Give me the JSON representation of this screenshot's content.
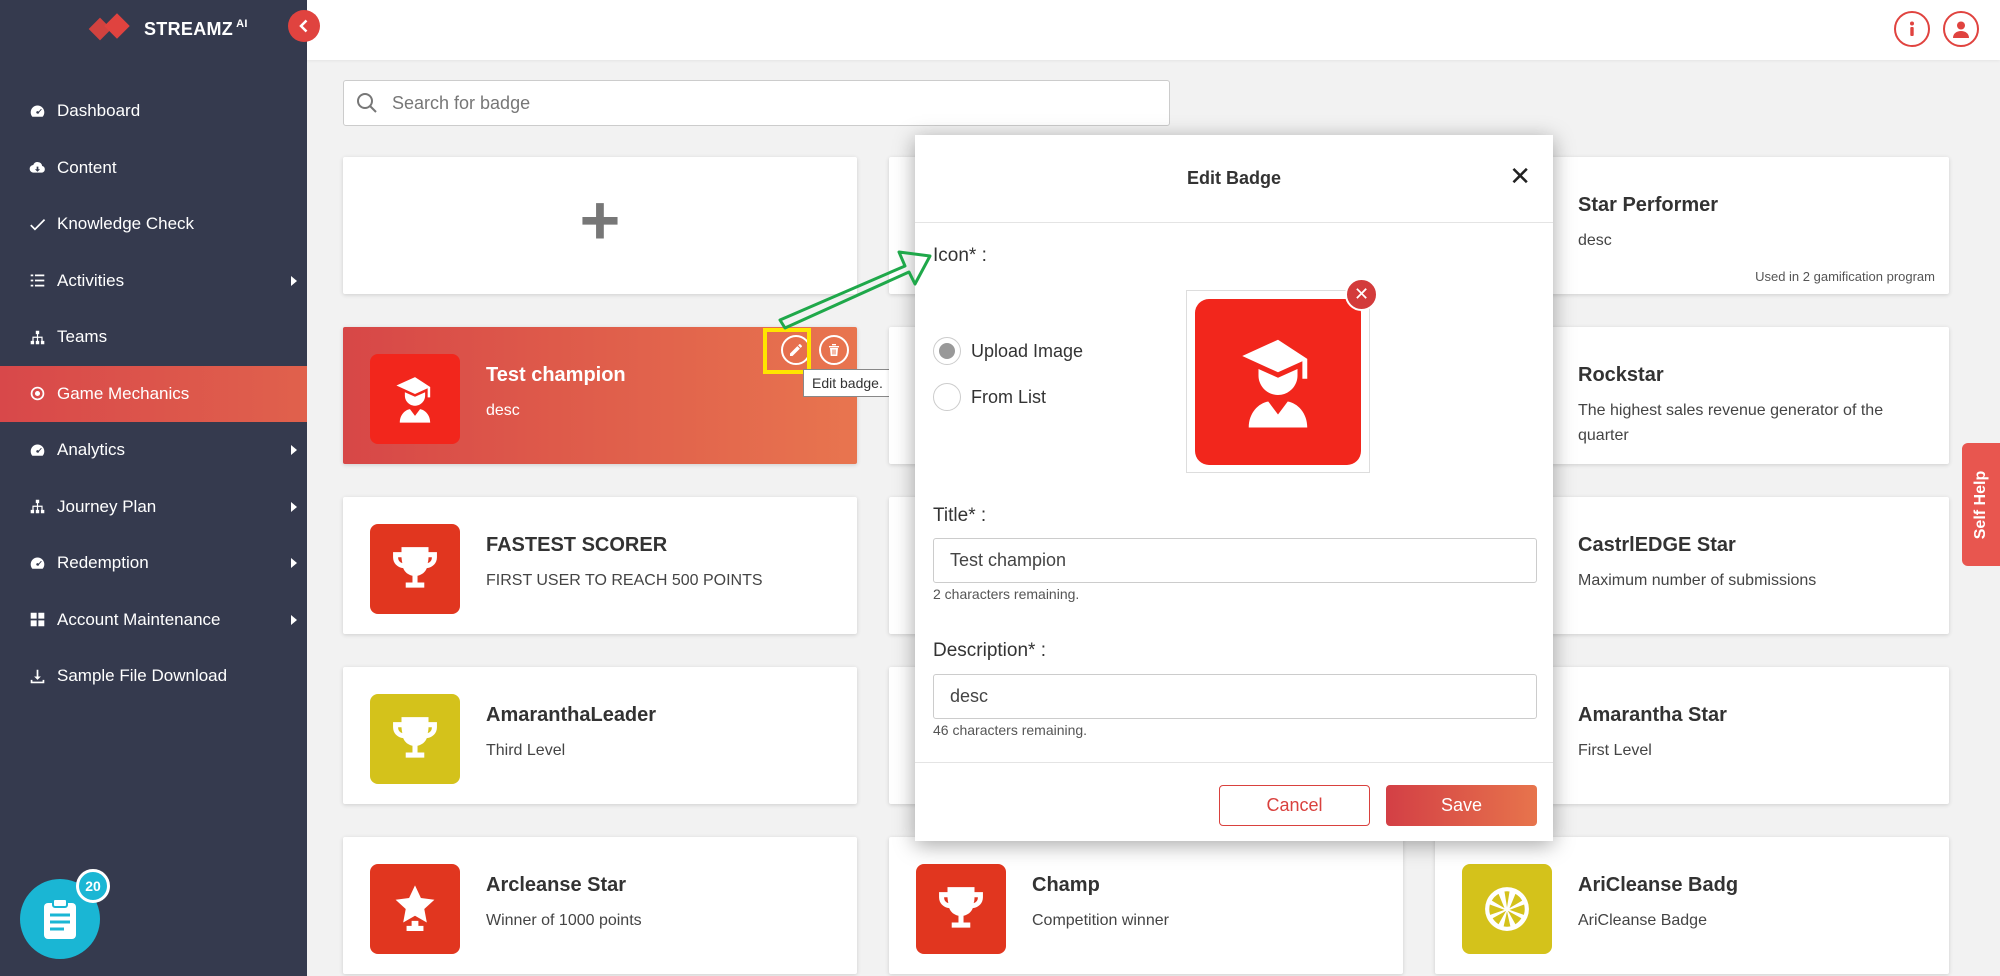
{
  "app": {
    "brand": "STREAMZ",
    "brand_sup": "AI"
  },
  "sidebar": {
    "items": [
      {
        "label": "Dashboard",
        "icon": "dashboard-icon",
        "caret": false,
        "active": false
      },
      {
        "label": "Content",
        "icon": "cloud-icon",
        "caret": false,
        "active": false
      },
      {
        "label": "Knowledge Check",
        "icon": "check-icon",
        "caret": false,
        "active": false
      },
      {
        "label": "Activities",
        "icon": "list-icon",
        "caret": true,
        "active": false
      },
      {
        "label": "Teams",
        "icon": "sitemap-icon",
        "caret": false,
        "active": false
      },
      {
        "label": "Game Mechanics",
        "icon": "target-icon",
        "caret": false,
        "active": true
      },
      {
        "label": "Analytics",
        "icon": "dashboard-icon",
        "caret": true,
        "active": false
      },
      {
        "label": "Journey Plan",
        "icon": "sitemap-icon",
        "caret": true,
        "active": false
      },
      {
        "label": "Redemption",
        "icon": "dashboard-icon",
        "caret": true,
        "active": false
      },
      {
        "label": "Account Maintenance",
        "icon": "grid-icon",
        "caret": true,
        "active": false
      },
      {
        "label": "Sample File Download",
        "icon": "download-icon",
        "caret": false,
        "active": false
      }
    ],
    "task_count": "20"
  },
  "search": {
    "placeholder": "Search for badge"
  },
  "cards": {
    "test_champion": {
      "title": "Test champion",
      "desc": "desc"
    },
    "fastest_scorer": {
      "title": "FASTEST SCORER",
      "desc": "FIRST USER TO REACH 500 POINTS"
    },
    "amarantha_leader": {
      "title": "AmaranthaLeader",
      "desc": "Third Level"
    },
    "arcleanse_star": {
      "title": "Arcleanse Star",
      "desc": "Winner of 1000 points"
    },
    "champ": {
      "title": "Champ",
      "desc": "Competition winner"
    },
    "star_performer": {
      "title": "Star Performer",
      "desc": "desc",
      "used": "Used in 2 gamification program"
    },
    "rockstar": {
      "title": "Rockstar",
      "desc": "The highest sales revenue generator of the quarter"
    },
    "castrledge_star": {
      "title": "CastrlEDGE Star",
      "desc": "Maximum number of submissions"
    },
    "amarantha_star": {
      "title": "Amarantha Star",
      "desc": "First Level"
    },
    "aricleanse_badg": {
      "title": "AriCleanse Badg",
      "desc": "AriCleanse Badge"
    }
  },
  "tooltip": "Edit badge.",
  "self_help": "Self Help",
  "modal": {
    "title": "Edit Badge",
    "close": "✕",
    "icon_label": "Icon* :",
    "upload_label": "Upload Image",
    "from_list_label": "From List",
    "title_label": "Title* :",
    "title_value": "Test champion",
    "title_hint": "2 characters remaining.",
    "desc_label": "Description* :",
    "desc_value": "desc",
    "desc_hint": "46 characters remaining.",
    "cancel": "Cancel",
    "save": "Save"
  },
  "colors": {
    "sidebar_bg": "#353a4e",
    "accent": "#e0433f",
    "badge_red": "#e1361f",
    "badge_yellow": "#d4c21b",
    "highlight": "#ffe500",
    "annotation_arrow": "#1fa84a"
  }
}
